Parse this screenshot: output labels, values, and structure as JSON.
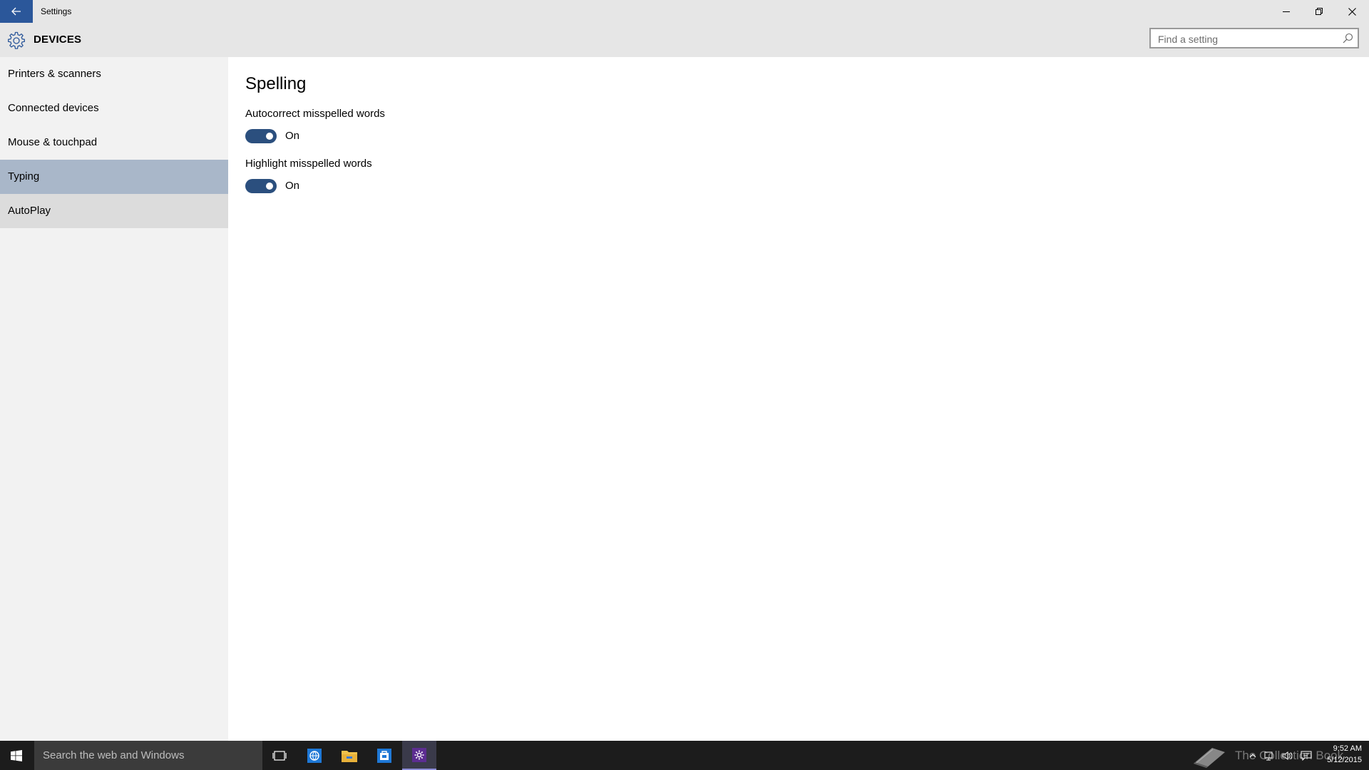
{
  "window": {
    "title": "Settings",
    "controls": [
      "minimize",
      "restore",
      "close"
    ]
  },
  "header": {
    "section": "DEVICES",
    "search_placeholder": "Find a setting"
  },
  "sidebar": {
    "items": [
      {
        "label": "Printers & scanners",
        "state": "normal"
      },
      {
        "label": "Connected devices",
        "state": "normal"
      },
      {
        "label": "Mouse & touchpad",
        "state": "normal"
      },
      {
        "label": "Typing",
        "state": "selected"
      },
      {
        "label": "AutoPlay",
        "state": "hover"
      }
    ]
  },
  "main": {
    "group_title": "Spelling",
    "settings": [
      {
        "label": "Autocorrect misspelled words",
        "value": true,
        "state_text": "On"
      },
      {
        "label": "Highlight misspelled words",
        "value": true,
        "state_text": "On"
      }
    ]
  },
  "taskbar": {
    "search_placeholder": "Search the web and Windows",
    "apps": [
      "task-view",
      "edge",
      "file-explorer",
      "store",
      "settings"
    ],
    "active_app": "settings",
    "watermark": "The Collection Book",
    "time": "9:52 AM",
    "date": "5/12/2015"
  },
  "colors": {
    "accent": "#2b579a",
    "toggle_on": "#2b4f7e",
    "nav_selected": "#a9b7c9",
    "chrome": "#e6e6e6",
    "sidebar_bg": "#f2f2f2",
    "taskbar_bg": "#1c1c1c"
  }
}
